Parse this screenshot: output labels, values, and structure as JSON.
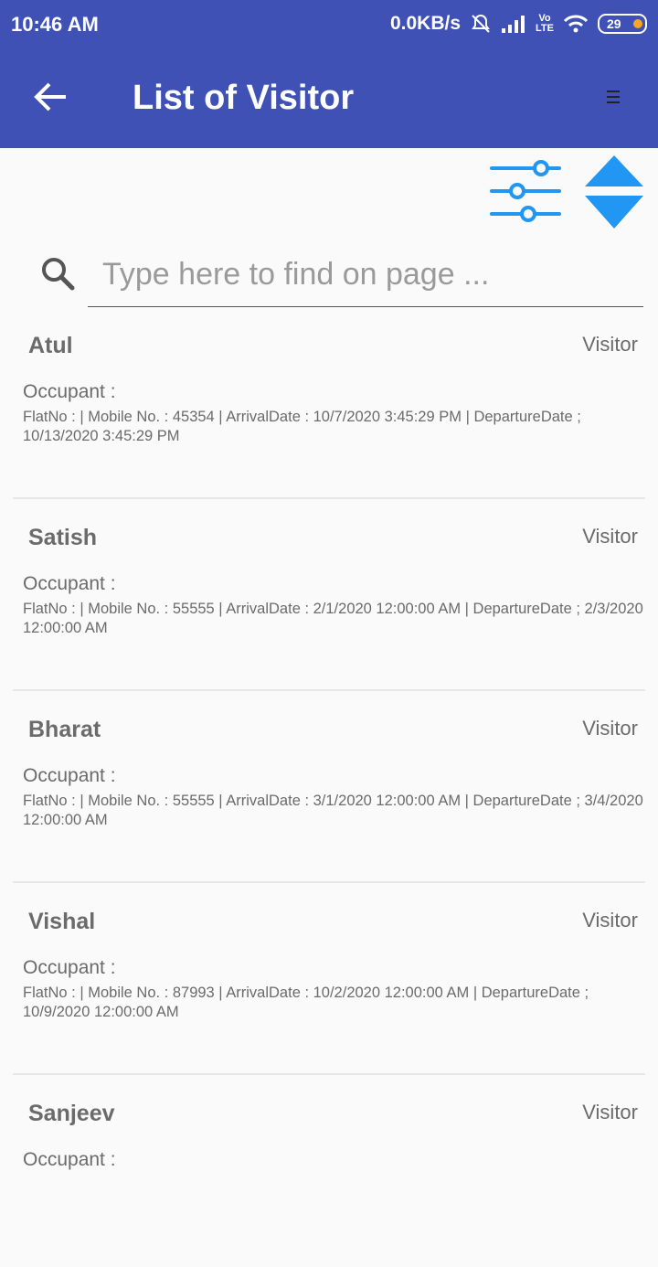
{
  "status_bar": {
    "time": "10:46 AM",
    "network_speed": "0.0KB/s",
    "volte": "VoLTE",
    "battery": "29"
  },
  "app_bar": {
    "title": "List of Visitor",
    "back_icon": "arrow-left-icon",
    "menu_icon": "menu-icon"
  },
  "toolbar": {
    "filter_icon": "sliders-filter-icon",
    "sort_icon": "sort-up-down-icon"
  },
  "search": {
    "placeholder": "Type here to find on page ...",
    "value": ""
  },
  "colors": {
    "primary": "#3f51b5",
    "accent": "#2196f3",
    "text": "#6b6b6b"
  },
  "visitors": [
    {
      "name": "Atul",
      "type": "Visitor",
      "occupant": "Occupant :",
      "details": "FlatNo :  | Mobile No. : 45354 | ArrivalDate : 10/7/2020 3:45:29 PM | DepartureDate ; 10/13/2020 3:45:29 PM"
    },
    {
      "name": "Satish",
      "type": "Visitor",
      "occupant": "Occupant :",
      "details": "FlatNo :  | Mobile No. : 55555 | ArrivalDate : 2/1/2020 12:00:00 AM | DepartureDate ; 2/3/2020 12:00:00 AM"
    },
    {
      "name": "Bharat",
      "type": "Visitor",
      "occupant": "Occupant :",
      "details": "FlatNo :  | Mobile No. : 55555 | ArrivalDate : 3/1/2020 12:00:00 AM | DepartureDate ; 3/4/2020 12:00:00 AM"
    },
    {
      "name": "Vishal",
      "type": "Visitor",
      "occupant": "Occupant :",
      "details": "FlatNo :  | Mobile No. : 87993 | ArrivalDate : 10/2/2020 12:00:00 AM | DepartureDate ; 10/9/2020 12:00:00 AM"
    },
    {
      "name": "Sanjeev",
      "type": "Visitor",
      "occupant": "Occupant :",
      "details": ""
    }
  ]
}
